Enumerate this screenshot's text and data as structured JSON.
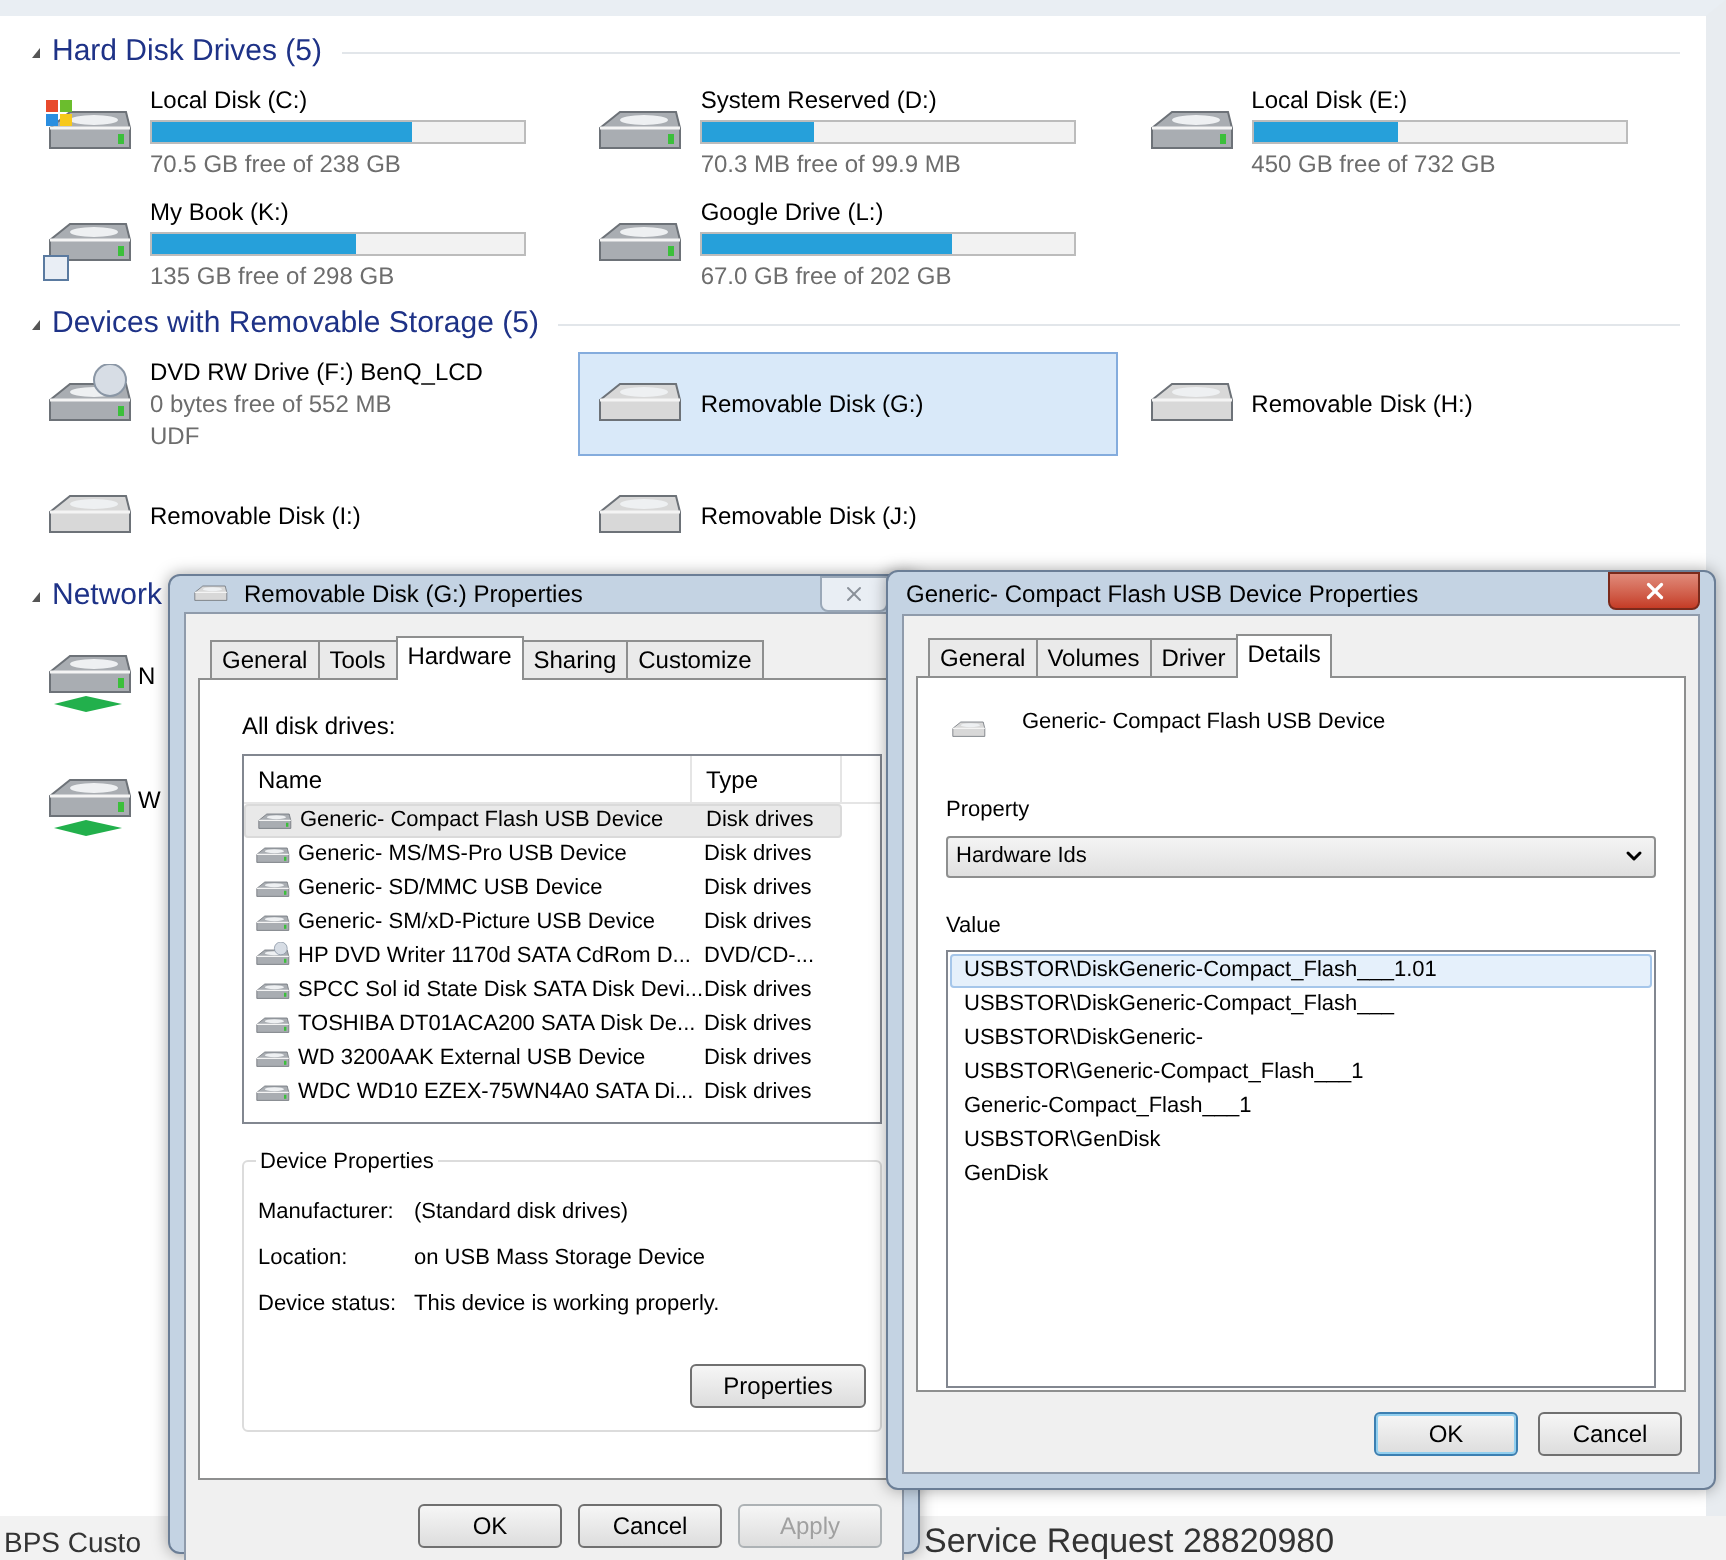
{
  "explorer": {
    "groups": [
      {
        "title": "Hard Disk Drives (5)",
        "items": [
          {
            "kind": "system",
            "name": "Local Disk (C:)",
            "level": 0.7,
            "detail": "70.5 GB free of 238 GB",
            "selected": false
          },
          {
            "kind": "hdd",
            "name": "System Reserved (D:)",
            "level": 0.3,
            "detail": "70.3 MB free of 99.9 MB",
            "selected": false
          },
          {
            "kind": "hdd",
            "name": "Local Disk (E:)",
            "level": 0.39,
            "detail": "450 GB free of 732 GB",
            "selected": false
          },
          {
            "kind": "book",
            "name": "My Book (K:)",
            "level": 0.55,
            "detail": "135 GB free of 298 GB",
            "selected": false
          },
          {
            "kind": "hdd",
            "name": "Google Drive (L:)",
            "level": 0.67,
            "detail": "67.0 GB free of 202 GB",
            "selected": false
          }
        ]
      },
      {
        "title": "Devices with Removable Storage (5)",
        "items": [
          {
            "kind": "optical",
            "name": "DVD RW Drive (F:) BenQ_LCD",
            "detail": "0 bytes free of 552 MB",
            "extra": "UDF",
            "selected": false
          },
          {
            "kind": "removable",
            "name": "Removable Disk (G:)",
            "selected": true
          },
          {
            "kind": "removable",
            "name": "Removable Disk (H:)",
            "selected": false
          },
          {
            "kind": "removable",
            "name": "Removable Disk (I:)",
            "selected": false
          },
          {
            "kind": "removable",
            "name": "Removable Disk (J:)",
            "selected": false
          }
        ]
      },
      {
        "title": "Network",
        "items": [
          {
            "kind": "network",
            "name": "N",
            "selected": false
          },
          {
            "kind": "network",
            "name": "W",
            "selected": false
          }
        ]
      }
    ]
  },
  "properties_dialog": {
    "title": "Removable Disk (G:) Properties",
    "tabs": [
      {
        "label": "General",
        "selected": false
      },
      {
        "label": "Tools",
        "selected": false
      },
      {
        "label": "Hardware",
        "selected": true
      },
      {
        "label": "Sharing",
        "selected": false
      },
      {
        "label": "Customize",
        "selected": false
      }
    ],
    "list_label": "All disk drives:",
    "columns": [
      "Name",
      "Type"
    ],
    "rows": [
      {
        "kind": "disk",
        "name": "Generic- Compact Flash USB Device",
        "type": "Disk drives",
        "selected": true
      },
      {
        "kind": "disk",
        "name": "Generic- MS/MS-Pro USB Device",
        "type": "Disk drives",
        "selected": false
      },
      {
        "kind": "disk",
        "name": "Generic- SD/MMC USB Device",
        "type": "Disk drives",
        "selected": false
      },
      {
        "kind": "disk",
        "name": "Generic- SM/xD-Picture USB Device",
        "type": "Disk drives",
        "selected": false
      },
      {
        "kind": "optical",
        "name": "HP DVD Writer 1170d SATA CdRom D...",
        "type": "DVD/CD-...",
        "selected": false
      },
      {
        "kind": "disk",
        "name": "SPCC Sol id State Disk SATA Disk Devi...",
        "type": "Disk drives",
        "selected": false
      },
      {
        "kind": "disk",
        "name": "TOSHIBA DT01ACA200 SATA Disk De...",
        "type": "Disk drives",
        "selected": false
      },
      {
        "kind": "disk",
        "name": "WD 3200AAK External USB Device",
        "type": "Disk drives",
        "selected": false
      },
      {
        "kind": "disk",
        "name": "WDC WD10 EZEX-75WN4A0 SATA Di...",
        "type": "Disk drives",
        "selected": false
      }
    ],
    "group_title": "Device Properties",
    "fields": [
      {
        "label": "Manufacturer:",
        "value": "(Standard disk drives)"
      },
      {
        "label": "Location:",
        "value": "on USB Mass Storage Device"
      },
      {
        "label": "Device status:",
        "value": "This device is working properly."
      }
    ],
    "properties_button": "Properties",
    "buttons": [
      {
        "label": "OK",
        "disabled": false
      },
      {
        "label": "Cancel",
        "disabled": false
      },
      {
        "label": "Apply",
        "disabled": true
      }
    ]
  },
  "device_dialog": {
    "title": "Generic- Compact Flash USB Device Properties",
    "tabs": [
      {
        "label": "General",
        "selected": false
      },
      {
        "label": "Volumes",
        "selected": false
      },
      {
        "label": "Driver",
        "selected": false
      },
      {
        "label": "Details",
        "selected": true
      }
    ],
    "device_name": "Generic- Compact Flash USB Device",
    "property_label": "Property",
    "property_value": "Hardware Ids",
    "value_label": "Value",
    "values": [
      {
        "text": "USBSTOR\\DiskGeneric-Compact_Flash___1.01",
        "selected": true
      },
      {
        "text": "USBSTOR\\DiskGeneric-Compact_Flash___",
        "selected": false
      },
      {
        "text": "USBSTOR\\DiskGeneric-",
        "selected": false
      },
      {
        "text": "USBSTOR\\Generic-Compact_Flash___1",
        "selected": false
      },
      {
        "text": "Generic-Compact_Flash___1",
        "selected": false
      },
      {
        "text": "USBSTOR\\GenDisk",
        "selected": false
      },
      {
        "text": "GenDisk",
        "selected": false
      }
    ],
    "buttons": [
      {
        "label": "OK",
        "default": true
      },
      {
        "label": "Cancel",
        "default": false
      }
    ]
  },
  "footer": [
    "BPS Custo",
    "Service Request 28820980"
  ]
}
